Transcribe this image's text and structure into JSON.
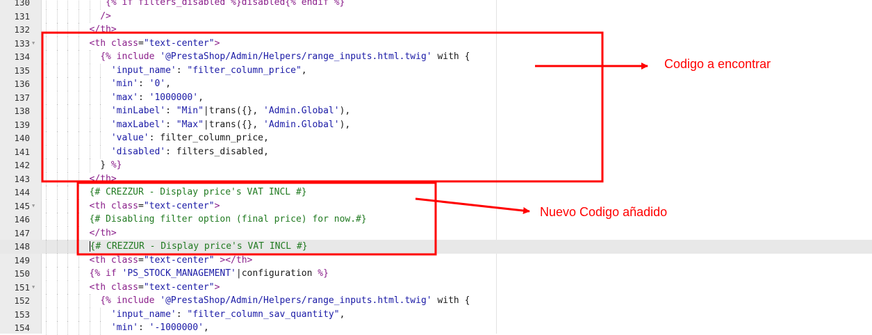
{
  "annotations": {
    "label_find": "Codigo a encontrar",
    "label_new": "Nuevo Codigo añadido",
    "color": "#ff0000"
  },
  "lines": [
    {
      "n": "130",
      "fold": false,
      "indent": 11,
      "active": false,
      "tokens": [
        {
          "c": "t-twig",
          "t": "{% if filters_disabled %}disabled{% endif %}"
        }
      ]
    },
    {
      "n": "131",
      "fold": false,
      "indent": 10,
      "active": false,
      "tokens": [
        {
          "c": "t-tag",
          "t": "/>"
        }
      ]
    },
    {
      "n": "132",
      "fold": false,
      "indent": 8,
      "active": false,
      "tokens": [
        {
          "c": "t-tag",
          "t": "</th>"
        }
      ]
    },
    {
      "n": "133",
      "fold": true,
      "indent": 8,
      "active": false,
      "tokens": [
        {
          "c": "t-tag",
          "t": "<th "
        },
        {
          "c": "t-attr",
          "t": "class"
        },
        {
          "c": "t-plain",
          "t": "="
        },
        {
          "c": "t-str",
          "t": "\"text-center\""
        },
        {
          "c": "t-tag",
          "t": ">"
        }
      ]
    },
    {
      "n": "134",
      "fold": false,
      "indent": 10,
      "active": false,
      "tokens": [
        {
          "c": "t-twig",
          "t": "{% include "
        },
        {
          "c": "t-str",
          "t": "'@PrestaShop/Admin/Helpers/range_inputs.html.twig'"
        },
        {
          "c": "t-plain",
          "t": " with {"
        }
      ]
    },
    {
      "n": "135",
      "fold": false,
      "indent": 12,
      "active": false,
      "tokens": [
        {
          "c": "t-str",
          "t": "'input_name'"
        },
        {
          "c": "t-plain",
          "t": ": "
        },
        {
          "c": "t-str",
          "t": "\"filter_column_price\""
        },
        {
          "c": "t-plain",
          "t": ","
        }
      ]
    },
    {
      "n": "136",
      "fold": false,
      "indent": 12,
      "active": false,
      "tokens": [
        {
          "c": "t-str",
          "t": "'min'"
        },
        {
          "c": "t-plain",
          "t": ": "
        },
        {
          "c": "t-str",
          "t": "'0'"
        },
        {
          "c": "t-plain",
          "t": ","
        }
      ]
    },
    {
      "n": "137",
      "fold": false,
      "indent": 12,
      "active": false,
      "tokens": [
        {
          "c": "t-str",
          "t": "'max'"
        },
        {
          "c": "t-plain",
          "t": ": "
        },
        {
          "c": "t-str",
          "t": "'1000000'"
        },
        {
          "c": "t-plain",
          "t": ","
        }
      ]
    },
    {
      "n": "138",
      "fold": false,
      "indent": 12,
      "active": false,
      "tokens": [
        {
          "c": "t-str",
          "t": "'minLabel'"
        },
        {
          "c": "t-plain",
          "t": ": "
        },
        {
          "c": "t-str",
          "t": "\"Min\""
        },
        {
          "c": "t-plain",
          "t": "|trans({}, "
        },
        {
          "c": "t-str",
          "t": "'Admin.Global'"
        },
        {
          "c": "t-plain",
          "t": "),"
        }
      ]
    },
    {
      "n": "139",
      "fold": false,
      "indent": 12,
      "active": false,
      "tokens": [
        {
          "c": "t-str",
          "t": "'maxLabel'"
        },
        {
          "c": "t-plain",
          "t": ": "
        },
        {
          "c": "t-str",
          "t": "\"Max\""
        },
        {
          "c": "t-plain",
          "t": "|trans({}, "
        },
        {
          "c": "t-str",
          "t": "'Admin.Global'"
        },
        {
          "c": "t-plain",
          "t": "),"
        }
      ]
    },
    {
      "n": "140",
      "fold": false,
      "indent": 12,
      "active": false,
      "tokens": [
        {
          "c": "t-str",
          "t": "'value'"
        },
        {
          "c": "t-plain",
          "t": ": filter_column_price,"
        }
      ]
    },
    {
      "n": "141",
      "fold": false,
      "indent": 12,
      "active": false,
      "tokens": [
        {
          "c": "t-str",
          "t": "'disabled'"
        },
        {
          "c": "t-plain",
          "t": ": filters_disabled,"
        }
      ]
    },
    {
      "n": "142",
      "fold": false,
      "indent": 10,
      "active": false,
      "tokens": [
        {
          "c": "t-plain",
          "t": "} "
        },
        {
          "c": "t-twig",
          "t": "%}"
        }
      ]
    },
    {
      "n": "143",
      "fold": false,
      "indent": 8,
      "active": false,
      "tokens": [
        {
          "c": "t-tag",
          "t": "</th>"
        }
      ]
    },
    {
      "n": "144",
      "fold": false,
      "indent": 8,
      "active": false,
      "tokens": [
        {
          "c": "t-com",
          "t": "{# CREZZUR - Display price's VAT INCL #}"
        }
      ]
    },
    {
      "n": "145",
      "fold": true,
      "indent": 8,
      "active": false,
      "tokens": [
        {
          "c": "t-tag",
          "t": "<th "
        },
        {
          "c": "t-attr",
          "t": "class"
        },
        {
          "c": "t-plain",
          "t": "="
        },
        {
          "c": "t-str",
          "t": "\"text-center\""
        },
        {
          "c": "t-tag",
          "t": ">"
        }
      ]
    },
    {
      "n": "146",
      "fold": false,
      "indent": 8,
      "active": false,
      "tokens": [
        {
          "c": "t-com",
          "t": "{# Disabling filter option (final price) for now.#}"
        }
      ]
    },
    {
      "n": "147",
      "fold": false,
      "indent": 8,
      "active": false,
      "tokens": [
        {
          "c": "t-tag",
          "t": "</th>"
        }
      ]
    },
    {
      "n": "148",
      "fold": false,
      "indent": 8,
      "active": true,
      "cursor": true,
      "tokens": [
        {
          "c": "t-com",
          "t": "{# CREZZUR - Display price's VAT INCL #}"
        }
      ]
    },
    {
      "n": "149",
      "fold": false,
      "indent": 8,
      "active": false,
      "tokens": [
        {
          "c": "t-tag",
          "t": "<th "
        },
        {
          "c": "t-attr",
          "t": "class"
        },
        {
          "c": "t-plain",
          "t": "="
        },
        {
          "c": "t-str",
          "t": "\"text-center\""
        },
        {
          "c": "t-tag",
          "t": " ></th>"
        }
      ]
    },
    {
      "n": "150",
      "fold": false,
      "indent": 8,
      "active": false,
      "tokens": [
        {
          "c": "t-twig",
          "t": "{% if "
        },
        {
          "c": "t-str",
          "t": "'PS_STOCK_MANAGEMENT'"
        },
        {
          "c": "t-plain",
          "t": "|configuration "
        },
        {
          "c": "t-twig",
          "t": "%}"
        }
      ]
    },
    {
      "n": "151",
      "fold": true,
      "indent": 8,
      "active": false,
      "tokens": [
        {
          "c": "t-tag",
          "t": "<th "
        },
        {
          "c": "t-attr",
          "t": "class"
        },
        {
          "c": "t-plain",
          "t": "="
        },
        {
          "c": "t-str",
          "t": "\"text-center\""
        },
        {
          "c": "t-tag",
          "t": ">"
        }
      ]
    },
    {
      "n": "152",
      "fold": false,
      "indent": 10,
      "active": false,
      "tokens": [
        {
          "c": "t-twig",
          "t": "{% include "
        },
        {
          "c": "t-str",
          "t": "'@PrestaShop/Admin/Helpers/range_inputs.html.twig'"
        },
        {
          "c": "t-plain",
          "t": " with {"
        }
      ]
    },
    {
      "n": "153",
      "fold": false,
      "indent": 12,
      "active": false,
      "tokens": [
        {
          "c": "t-str",
          "t": "'input_name'"
        },
        {
          "c": "t-plain",
          "t": ": "
        },
        {
          "c": "t-str",
          "t": "\"filter_column_sav_quantity\""
        },
        {
          "c": "t-plain",
          "t": ","
        }
      ]
    },
    {
      "n": "154",
      "fold": false,
      "indent": 12,
      "active": false,
      "tokens": [
        {
          "c": "t-str",
          "t": "'min'"
        },
        {
          "c": "t-plain",
          "t": ": "
        },
        {
          "c": "t-str",
          "t": "'-1000000'"
        },
        {
          "c": "t-plain",
          "t": ","
        }
      ]
    }
  ]
}
